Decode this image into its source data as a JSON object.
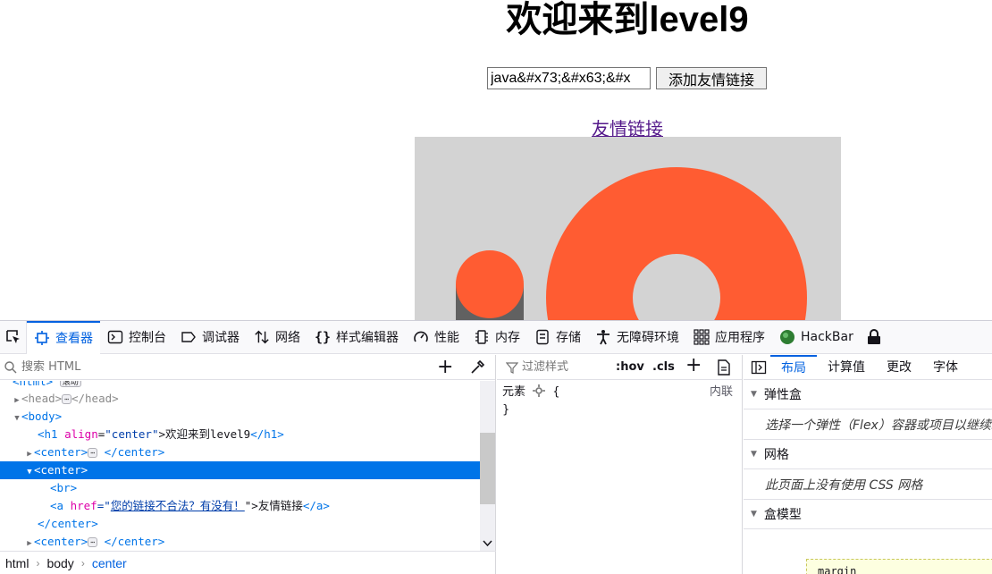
{
  "page": {
    "heading": "欢迎来到level9",
    "input_value": "java&#x73;&#x63;&#x",
    "add_button": "添加友情链接",
    "friend_link": "友情链接"
  },
  "devtools": {
    "tabs": [
      {
        "label": "查看器",
        "icon": "inspector-icon"
      },
      {
        "label": "控制台",
        "icon": "console-icon"
      },
      {
        "label": "调试器",
        "icon": "debugger-icon"
      },
      {
        "label": "网络",
        "icon": "network-icon"
      },
      {
        "label": "样式编辑器",
        "icon": "style-editor-icon"
      },
      {
        "label": "性能",
        "icon": "performance-icon"
      },
      {
        "label": "内存",
        "icon": "memory-icon"
      },
      {
        "label": "存储",
        "icon": "storage-icon"
      },
      {
        "label": "无障碍环境",
        "icon": "accessibility-icon"
      },
      {
        "label": "应用程序",
        "icon": "application-icon"
      },
      {
        "label": "HackBar",
        "icon": "hackbar-icon"
      }
    ],
    "markup": {
      "search_placeholder": "搜索 HTML",
      "lines": {
        "html_partial": "<html>",
        "html_badge": "滚动",
        "head_open": "<head>",
        "head_close": "</head>",
        "body_open": "<body>",
        "h1_open": "<h1",
        "h1_attr": "align",
        "h1_attr_value": "\"center\"",
        "h1_text": ">欢迎来到level9",
        "h1_close": "</h1>",
        "center_open": "<center>",
        "center_close": "</center>",
        "br": "<br>",
        "a_open": "<a",
        "a_attr": "href",
        "a_eq_quote": "=\"",
        "a_attr_value": "您的链接不合法？有没有！",
        "a_close_quote": "\">友情链接",
        "a_close": "</a>",
        "ellipsis": "⋯"
      },
      "breadcrumbs": [
        "html",
        "body",
        "center"
      ]
    },
    "rules": {
      "filter_placeholder": "过滤样式",
      "hov": ":hov",
      "cls": ".cls",
      "element_label": "元素",
      "open_brace": "{",
      "close_brace": "}",
      "inline_label": "内联"
    },
    "layout": {
      "tabs": [
        "布局",
        "计算值",
        "更改",
        "字体"
      ],
      "flexbox_title": "弹性盒",
      "flexbox_hint": "选择一个弹性（Flex）容器或项目以继续。",
      "grid_title": "网格",
      "grid_hint": "此页面上没有使用 CSS 网格",
      "boxmodel_title": "盒模型",
      "margin_label": "margin"
    }
  }
}
